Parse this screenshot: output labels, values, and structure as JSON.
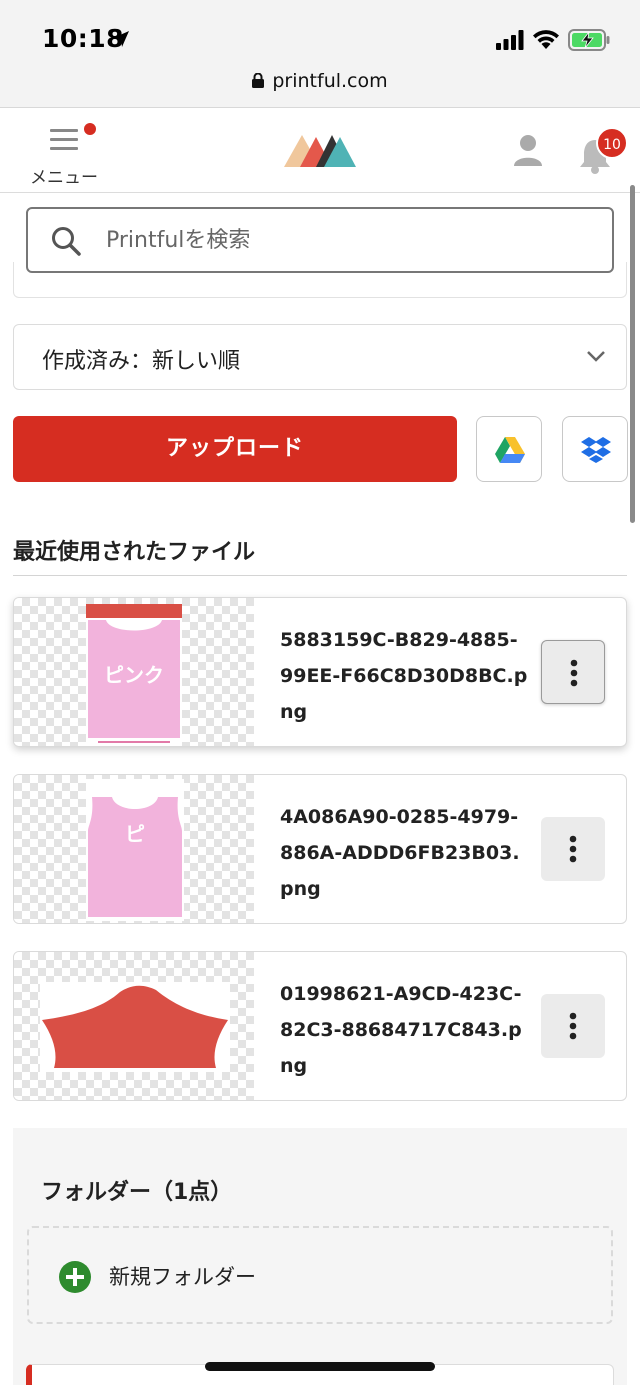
{
  "status_bar": {
    "time": "10:18",
    "url": "printful.com"
  },
  "header": {
    "menu_label": "メニュー",
    "notification_count": "10"
  },
  "search": {
    "placeholder": "Printfulを検索"
  },
  "sort": {
    "selected": "作成済み：新しい順"
  },
  "actions": {
    "upload_label": "アップロード"
  },
  "recent_files": {
    "title": "最近使用されたファイル",
    "items": [
      {
        "name": "5883159C-B829-4885-99EE-F66C8D30D8BC.png",
        "thumb_text": "ピンク"
      },
      {
        "name": "4A086A90-0285-4979-886A-ADDD6FB23B03.png",
        "thumb_text": "ピ"
      },
      {
        "name": "01998621-A9CD-423C-82C3-88684717C843.png",
        "thumb_text": ""
      }
    ]
  },
  "folders": {
    "title": "フォルダー（1点）",
    "new_folder_label": "新規フォルダー"
  },
  "colors": {
    "brand_red": "#d62d21",
    "shirt_pink": "#f2b3dc",
    "sleeve_red": "#d94f45"
  }
}
